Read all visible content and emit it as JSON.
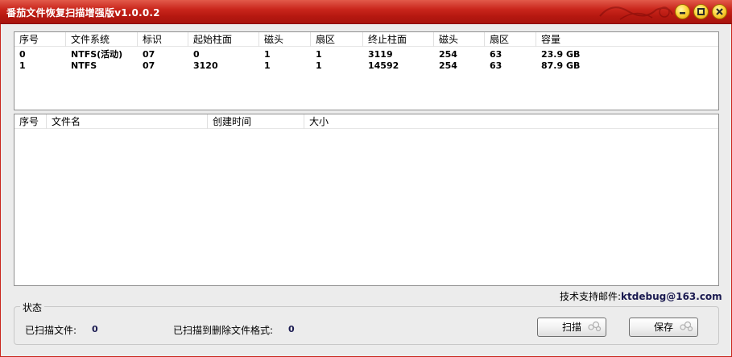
{
  "window": {
    "title": "番茄文件恢复扫描增强版v1.0.0.2",
    "accent": "#c9261c"
  },
  "partitions": {
    "columns": [
      "序号",
      "文件系统",
      "标识",
      "起始柱面",
      "磁头",
      "扇区",
      "终止柱面",
      "磁头",
      "扇区",
      "容量"
    ],
    "rows": [
      [
        "0",
        "NTFS(活动)",
        "07",
        "0",
        "1",
        "1",
        "3119",
        "254",
        "63",
        "23.9 GB"
      ],
      [
        "1",
        "NTFS",
        "07",
        "3120",
        "1",
        "1",
        "14592",
        "254",
        "63",
        "87.9 GB"
      ]
    ]
  },
  "files": {
    "columns": [
      "序号",
      "文件名",
      "创建时间",
      "大小"
    ],
    "rows": []
  },
  "support": {
    "label": "技术支持邮件:",
    "email": "ktdebug@163.com"
  },
  "status": {
    "group_label": "状态",
    "scanned_files_label": "已扫描文件:",
    "scanned_files_value": "0",
    "deleted_formats_label": "已扫描到删除文件格式:",
    "deleted_formats_value": "0"
  },
  "buttons": {
    "scan": "扫描",
    "save": "保存"
  },
  "icons": {
    "minimize": "minimize-icon",
    "maximize": "maximize-icon",
    "close": "close-icon"
  }
}
